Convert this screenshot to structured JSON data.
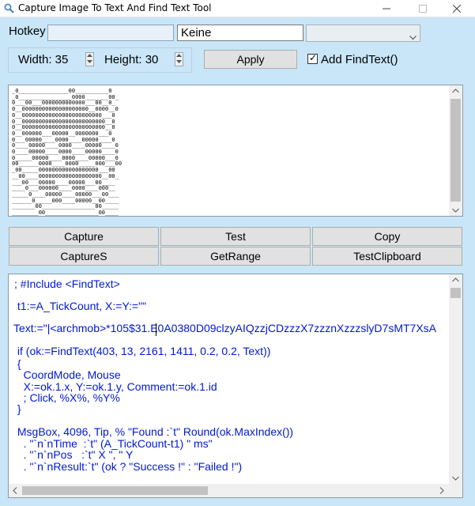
{
  "window": {
    "title": "Capture Image To Text And Find Text Tool"
  },
  "hotkey": {
    "label": "Hotkey",
    "value": "",
    "key_value": "Keine",
    "combo_value": ""
  },
  "size": {
    "width_label": "Width: 35",
    "height_label": "Height: 30"
  },
  "apply_label": "Apply",
  "add_findtext": {
    "label": "Add FindText()",
    "checked": true,
    "check_glyph": "✓"
  },
  "preview": {
    "lines": [
      "_0_______________00__________0",
      "_0________________0000_______00_",
      "0___00___0000000000000___00__0_",
      "0__00000000000000000000__0000__0",
      "0__000000000000000000000000___0",
      "0__0000000000000000000000000__0",
      "0__0000000000000000000000000__0",
      "0__000000___00000__0000000___0",
      "0___00000____0000____00000____0",
      "0____00000____0000____00000____0",
      "0____00000____0000____00000____0",
      "0_____00000____0000____00000___0",
      "00______0000____0000_____000___00",
      "_00_____000000000000000000___00",
      "__00____0000000000000000000__00_",
      "___00___00000____00000___00____",
      "____0___000000____0000____000__",
      "_____0____00000____00000___00___",
      "______0_____000____00000__00____",
      "_______00________________00_____",
      "________00________________00____"
    ]
  },
  "buttons": {
    "capture": "Capture",
    "test": "Test",
    "copy": "Copy",
    "captures": "CaptureS",
    "getrange": "GetRange",
    "testclipboard": "TestClipboard"
  },
  "code": {
    "lines": [
      "; #Include <FindText>",
      " t1:=A_TickCount, X:=Y:=\"\"",
      "Text:=\"|<archmob>*105$31.E0A0380D09clzyAIQzzjCDzzzX7zzznXzzzslyD7sMT7XsA",
      " if (ok:=FindText(403, 13, 2161, 1411, 0.2, 0.2, Text))",
      " {",
      "   CoordMode, Mouse",
      "   X:=ok.1.x, Y:=ok.1.y, Comment:=ok.1.id",
      "   ; Click, %X%, %Y%",
      " }",
      " MsgBox, 4096, Tip, % \"Found :`t\" Round(ok.MaxIndex())",
      "   . \"`n`nTime  :`t\" (A_TickCount-t1) \" ms\"",
      "   . \"`n`nPos   :`t\" X \", \" Y",
      "   . \"`n`nResult:`t\" (ok ? \"Success !\" : \"Failed !\")"
    ]
  },
  "colors": {
    "background": "#c9e6f8",
    "code_text": "#0018d6"
  }
}
